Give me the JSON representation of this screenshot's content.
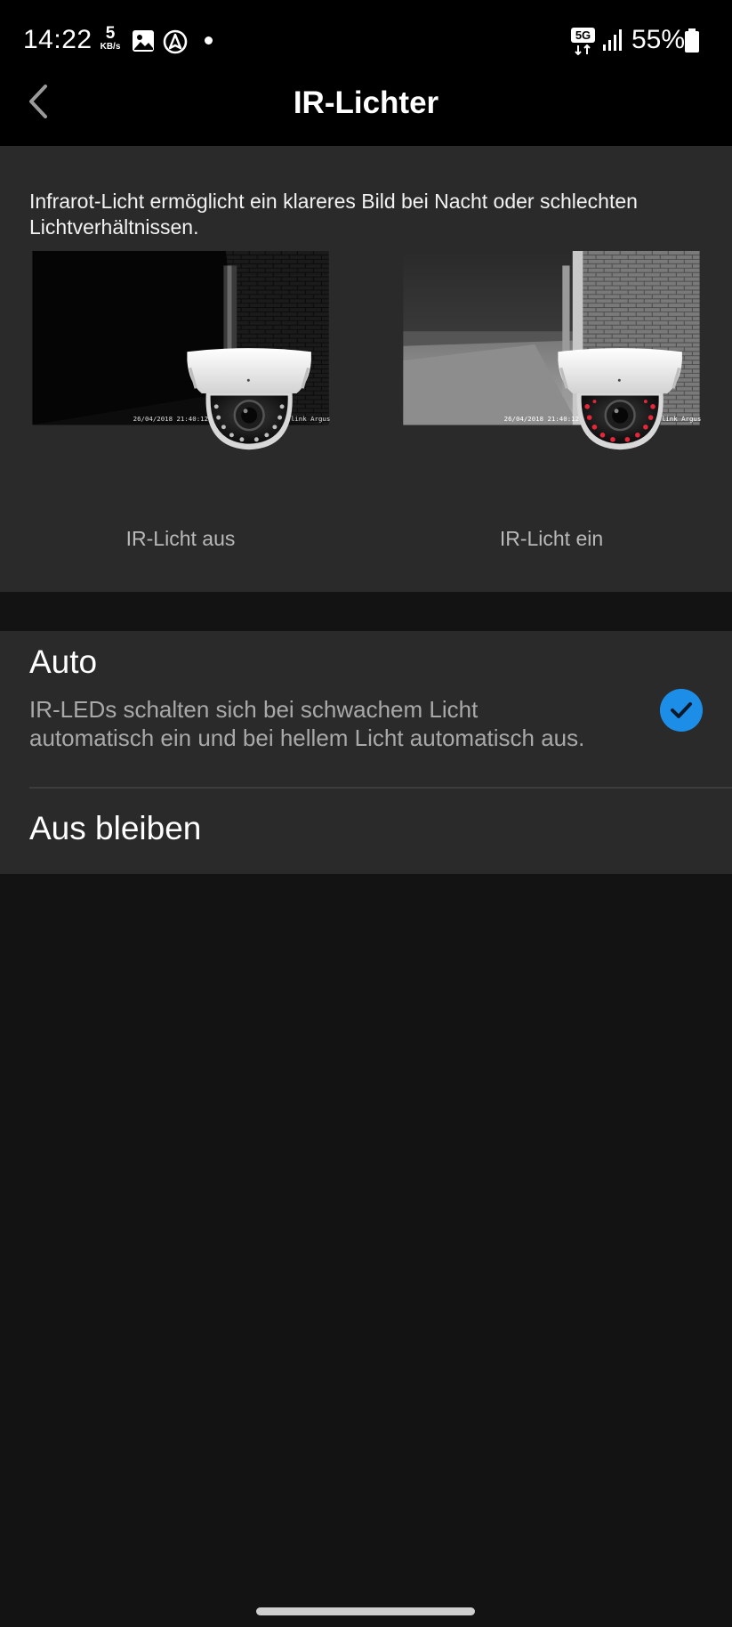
{
  "status_bar": {
    "time": "14:22",
    "net_speed_value": "5",
    "net_speed_unit": "KB/s",
    "network_badge": "5G",
    "battery": "55%",
    "icons": [
      "gallery-icon",
      "navigation-icon",
      "notification-dot",
      "5g-icon",
      "signal-icon",
      "battery-icon"
    ]
  },
  "header": {
    "title": "IR-Lichter",
    "back_icon": "chevron-left-icon"
  },
  "info": {
    "description": "Infrarot-Licht ermöglicht ein klareres Bild bei Nacht oder schlechten Lichtverhältnissen.",
    "previews": [
      {
        "label": "IR-Licht aus",
        "timestamp": "26/04/2018 21:40:12",
        "brand": "link Argus"
      },
      {
        "label": "IR-Licht ein",
        "timestamp": "26/04/2018 21:40:12",
        "brand": "link Argus"
      }
    ]
  },
  "options": [
    {
      "title": "Auto",
      "description": "IR-LEDs schalten sich bei schwachem Licht automatisch ein und bei hellem Licht automatisch aus.",
      "selected": true
    },
    {
      "title": "Aus bleiben",
      "selected": false
    }
  ],
  "colors": {
    "accent": "#1c8ee8",
    "background": "#131313",
    "surface": "#2a2a2a",
    "ir_led": "#e8263a"
  }
}
